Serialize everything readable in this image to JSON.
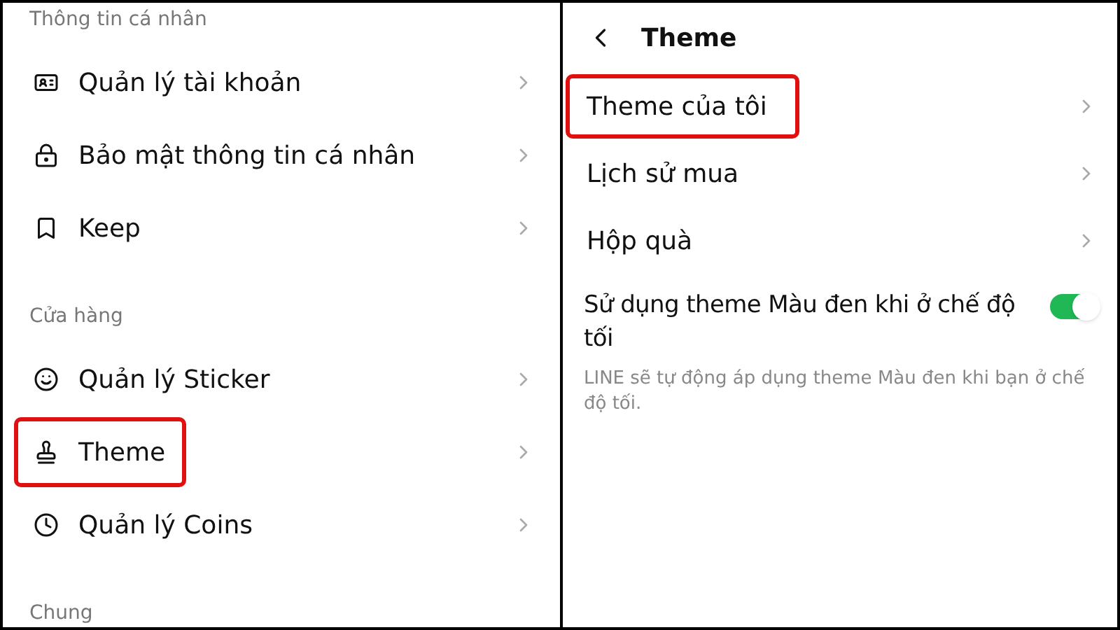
{
  "settings": {
    "sections": [
      {
        "title": "Thông tin cá nhân",
        "items": [
          {
            "label": "Quản lý tài khoản",
            "highlighted": false
          },
          {
            "label": "Bảo mật thông tin cá nhân",
            "highlighted": false
          },
          {
            "label": "Keep",
            "highlighted": false
          }
        ]
      },
      {
        "title": "Cửa hàng",
        "items": [
          {
            "label": "Quản lý Sticker",
            "highlighted": false
          },
          {
            "label": "Theme",
            "highlighted": true
          },
          {
            "label": "Quản lý Coins",
            "highlighted": false
          }
        ]
      },
      {
        "title": "Chung"
      }
    ]
  },
  "theme_screen": {
    "title": "Theme",
    "items": [
      {
        "label": "Theme của tôi",
        "highlighted": true
      },
      {
        "label": "Lịch sử mua",
        "highlighted": false
      },
      {
        "label": "Hộp quà",
        "highlighted": false
      }
    ],
    "toggle": {
      "label": "Sử dụng theme Màu đen khi ở chế độ tối",
      "on": true,
      "description": "LINE sẽ tự động áp dụng theme Màu đen khi bạn ở chế độ tối."
    }
  }
}
